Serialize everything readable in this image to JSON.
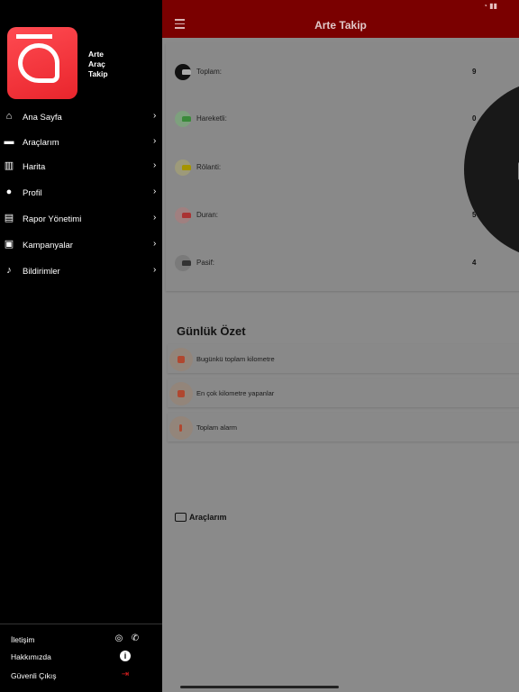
{
  "app": {
    "title": "Arte Takip",
    "brand_lines": [
      "Arte",
      "Araç",
      "Takip"
    ]
  },
  "drawer": {
    "items": [
      {
        "label": "Ana Sayfa",
        "icon": "home-icon"
      },
      {
        "label": "Araçlarım",
        "icon": "car-icon"
      },
      {
        "label": "Harita",
        "icon": "map-icon"
      },
      {
        "label": "Profil",
        "icon": "user-icon"
      },
      {
        "label": "Rapor Yönetimi",
        "icon": "report-icon"
      },
      {
        "label": "Kampanyalar",
        "icon": "gift-icon"
      },
      {
        "label": "Bildirimler",
        "icon": "bell-icon"
      }
    ],
    "footer": {
      "contact_label": "İletişim",
      "about_label": "Hakkımızda",
      "logout_label": "Güvenli Çıkış"
    }
  },
  "stats": [
    {
      "label": "Toplam:",
      "value": "9",
      "color": "#111111"
    },
    {
      "label": "Hareketli:",
      "value": "0",
      "color": "#3aa63a"
    },
    {
      "label": "Rölanti:",
      "value": "",
      "color": "#b9a600"
    },
    {
      "label": "Duran:",
      "value": "5",
      "color": "#b83a3a"
    },
    {
      "label": "Pasif:",
      "value": "4",
      "color": "#5a5a5a"
    }
  ],
  "daily_summary": {
    "title": "Günlük Özet",
    "items": [
      {
        "label": "Bugünkü toplam kilometre"
      },
      {
        "label": "En çok kilometre yapanlar"
      },
      {
        "label": "Toplam alarm"
      }
    ]
  },
  "vehicles_section": {
    "label": "Araçlarım"
  },
  "colors": {
    "accent": "#7a0000",
    "drawer_bg": "#000000",
    "logo_red": "#ee2c33"
  }
}
